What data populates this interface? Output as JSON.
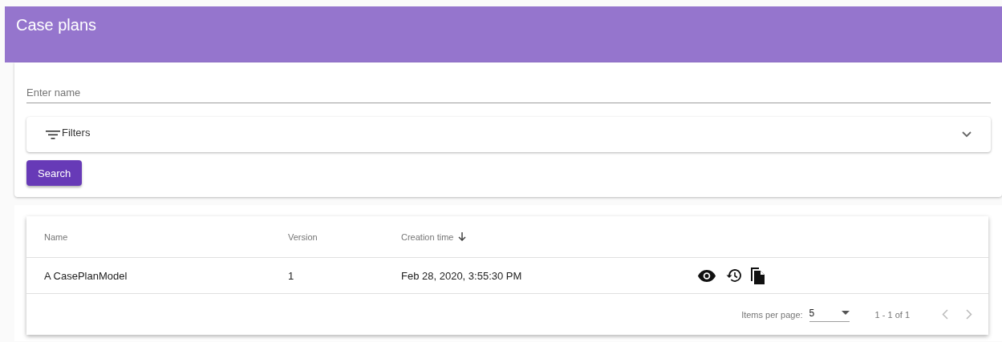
{
  "header": {
    "title": "Case plans"
  },
  "search": {
    "placeholder": "Enter name"
  },
  "filters": {
    "label": "Filters",
    "expanded": false
  },
  "search_button": "Search",
  "table": {
    "columns": [
      {
        "label": "Name",
        "sorted": false
      },
      {
        "label": "Version",
        "sorted": false
      },
      {
        "label": "Creation time",
        "sorted": true
      }
    ],
    "rows": [
      {
        "cells": [
          "A CasePlanModel",
          "1",
          "Feb 28, 2020, 3:55:30 PM"
        ]
      }
    ]
  },
  "paginator": {
    "label": "Items per page:",
    "page_size": "5",
    "range": "1 - 1 of 1"
  }
}
